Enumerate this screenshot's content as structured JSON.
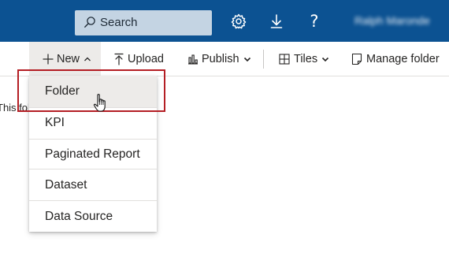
{
  "header": {
    "search_placeholder": "Search",
    "icons": [
      "search-icon",
      "gear-icon",
      "download-icon",
      "help-icon"
    ],
    "help_glyph": "?",
    "user_name": "Ralph Maronde",
    "colors": {
      "bar": "#0c5292",
      "search_bg": "#c4d4e3"
    }
  },
  "toolbar": {
    "new_label": "New",
    "upload_label": "Upload",
    "publish_label": "Publish",
    "tiles_label": "Tiles",
    "manage_label": "Manage folder"
  },
  "page": {
    "partial_text": "This fol"
  },
  "new_menu": {
    "items": [
      {
        "label": "Folder"
      },
      {
        "label": "KPI"
      },
      {
        "label": "Paginated Report"
      },
      {
        "label": "Dataset"
      },
      {
        "label": "Data Source"
      }
    ],
    "hovered_item": "Folder",
    "highlight_color": "#b41e24"
  }
}
